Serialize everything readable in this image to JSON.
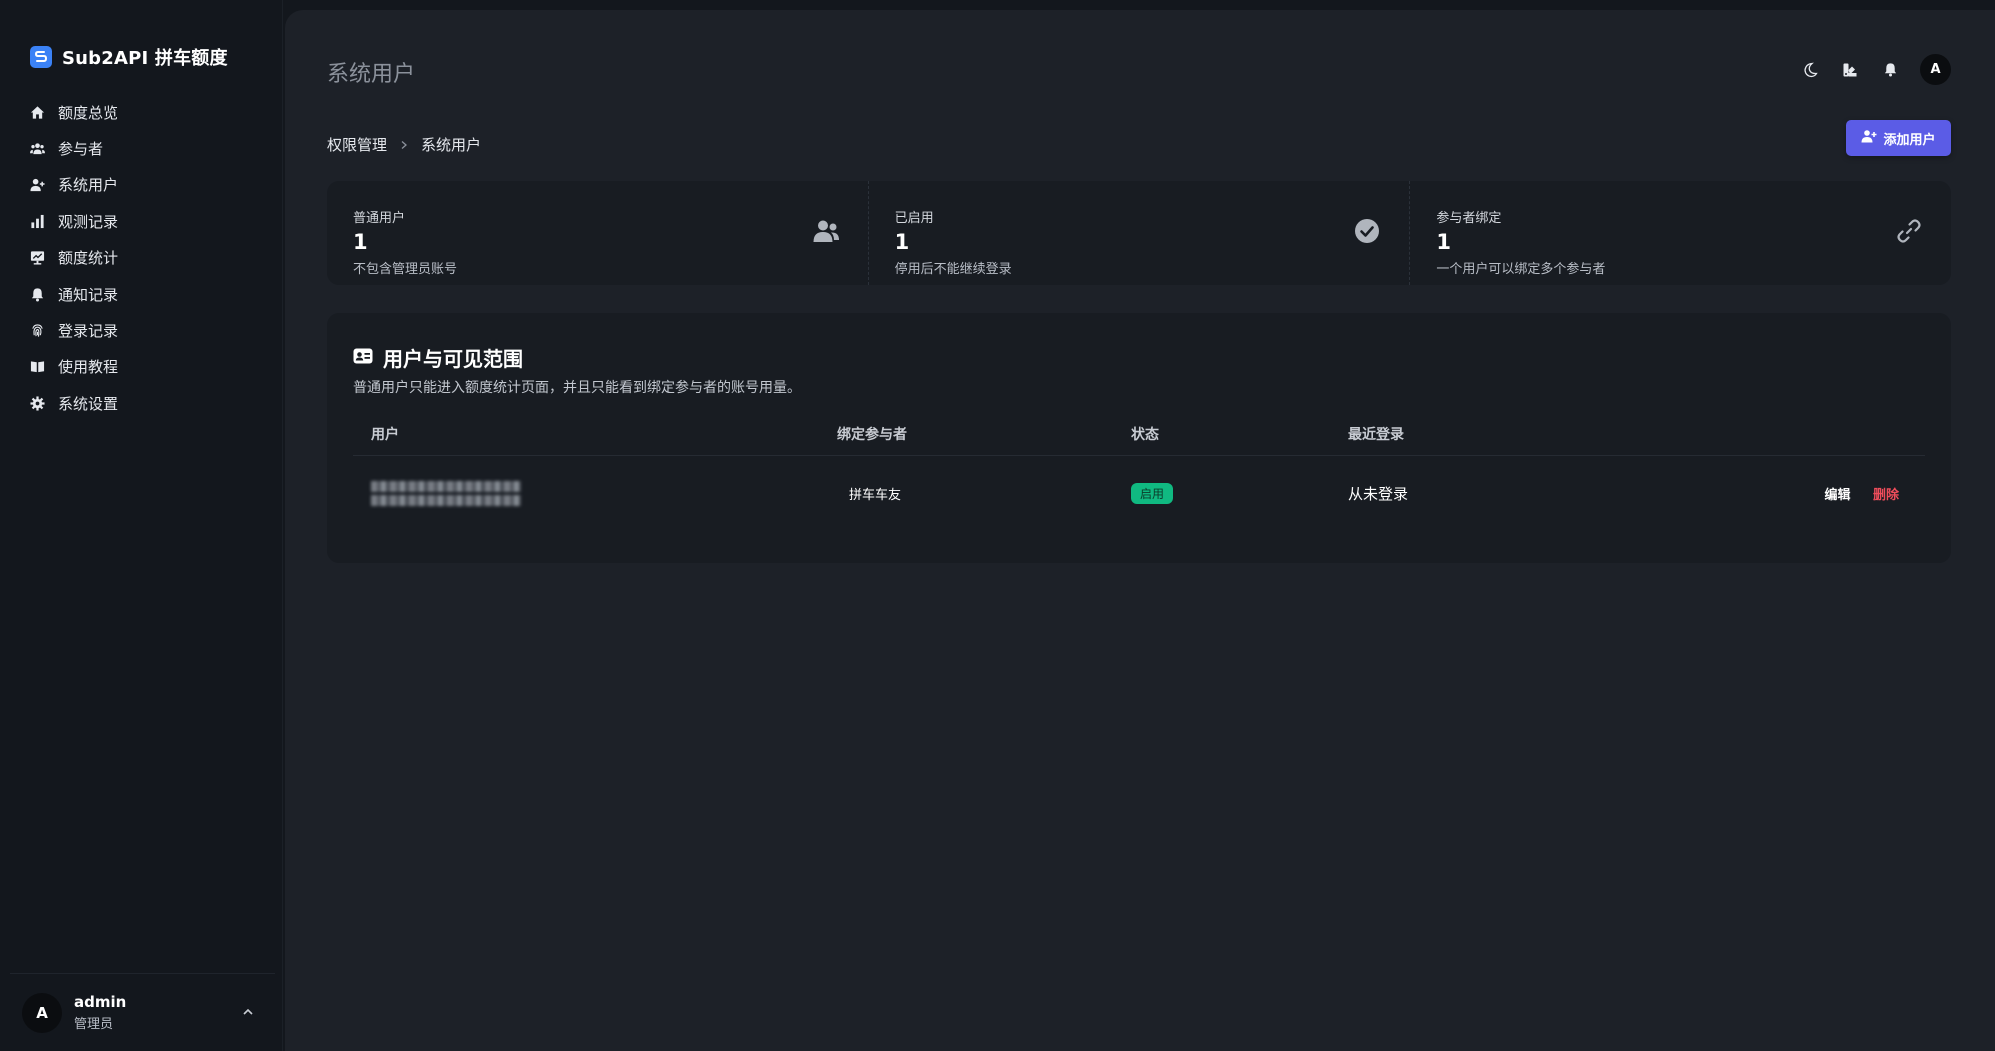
{
  "app": {
    "brand_title": "Sub2API 拼车额度",
    "logo_letter": "S"
  },
  "sidebar": {
    "items": [
      {
        "label": "额度总览",
        "icon": "home-icon"
      },
      {
        "label": "参与者",
        "icon": "users-icon"
      },
      {
        "label": "系统用户",
        "icon": "user-plus-icon"
      },
      {
        "label": "观测记录",
        "icon": "bar-chart-icon"
      },
      {
        "label": "额度统计",
        "icon": "chart-board-icon"
      },
      {
        "label": "通知记录",
        "icon": "bell-icon"
      },
      {
        "label": "登录记录",
        "icon": "fingerprint-icon"
      },
      {
        "label": "使用教程",
        "icon": "book-icon"
      },
      {
        "label": "系统设置",
        "icon": "gear-icon"
      }
    ],
    "user": {
      "avatar_letter": "A",
      "name": "admin",
      "role": "管理员"
    }
  },
  "header": {
    "page_title": "系统用户",
    "avatar_letter": "A",
    "icons": [
      "moon-icon",
      "palette-icon",
      "bell-icon"
    ]
  },
  "breadcrumb": {
    "parent": "权限管理",
    "current": "系统用户"
  },
  "toolbar": {
    "add_user_label": "添加用户"
  },
  "stats": [
    {
      "label": "普通用户",
      "value": "1",
      "desc": "不包含管理员账号",
      "icon": "users-icon"
    },
    {
      "label": "已启用",
      "value": "1",
      "desc": "停用后不能继续登录",
      "icon": "check-circle-icon"
    },
    {
      "label": "参与者绑定",
      "value": "1",
      "desc": "一个用户可以绑定多个参与者",
      "icon": "link-icon"
    }
  ],
  "card": {
    "title": "用户与可见范围",
    "desc": "普通用户只能进入额度统计页面，并且只能看到绑定参与者的账号用量。",
    "columns": {
      "user": "用户",
      "bind": "绑定参与者",
      "status": "状态",
      "last_login": "最近登录"
    },
    "rows": [
      {
        "bind": "拼车车友",
        "status": "启用",
        "last_login": "从未登录",
        "edit": "编辑",
        "delete": "删除"
      }
    ]
  },
  "colors": {
    "accent": "#5b5ce6",
    "success": "#10b981",
    "danger": "#ef4d5b",
    "brand": "#3b82f6"
  }
}
